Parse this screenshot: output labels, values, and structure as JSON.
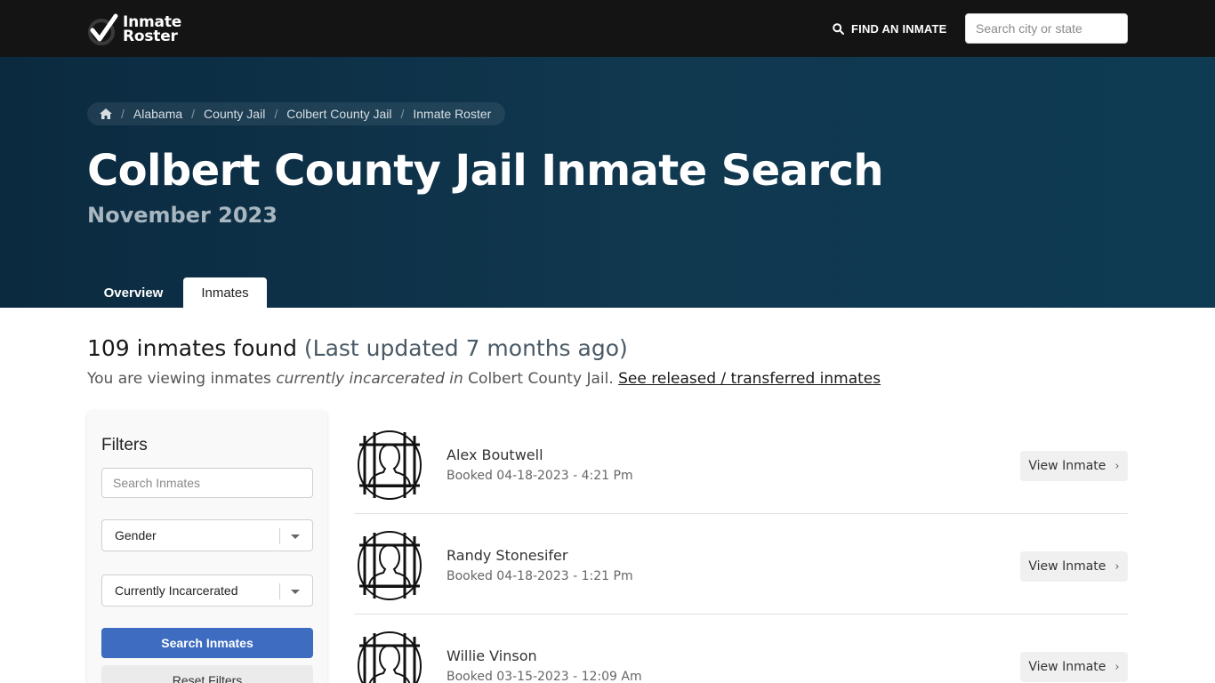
{
  "header": {
    "logo_line1": "Inmate",
    "logo_line2": "Roster",
    "find_label": "FIND AN INMATE",
    "search_placeholder": "Search city or state"
  },
  "breadcrumb": [
    "Alabama",
    "County Jail",
    "Colbert County Jail",
    "Inmate Roster"
  ],
  "hero": {
    "title": "Colbert County Jail Inmate Search",
    "subtitle": "November 2023"
  },
  "tabs": [
    {
      "label": "Overview",
      "active": false
    },
    {
      "label": "Inmates",
      "active": true
    }
  ],
  "results": {
    "count_text": "109 inmates found",
    "updated_text": "(Last updated 7 months ago)",
    "viewing_prefix": "You are viewing inmates ",
    "viewing_emphasis": "currently incarcerated in",
    "viewing_suffix": " Colbert County Jail. ",
    "released_link": "See released / transferred inmates"
  },
  "filters": {
    "title": "Filters",
    "search_placeholder": "Search Inmates",
    "gender_value": "Gender",
    "status_value": "Currently Incarcerated",
    "search_button": "Search Inmates",
    "reset_button": "Reset Filters"
  },
  "inmates": [
    {
      "name": "Alex Boutwell",
      "booked": "Booked 04-18-2023 - 4:21 Pm",
      "action": "View Inmate"
    },
    {
      "name": "Randy Stonesifer",
      "booked": "Booked 04-18-2023 - 1:21 Pm",
      "action": "View Inmate"
    },
    {
      "name": "Willie Vinson",
      "booked": "Booked 03-15-2023 - 12:09 Am",
      "action": "View Inmate"
    }
  ],
  "colors": {
    "topbar": "#141414",
    "hero": "#0e3a52",
    "primary_button": "#3d6cc0"
  }
}
